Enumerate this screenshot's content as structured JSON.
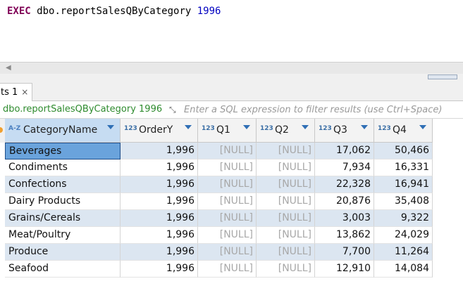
{
  "editor": {
    "keyword": "EXEC",
    "procedure": "dbo.reportSalesQByCategory",
    "argument": "1996"
  },
  "results_tab": {
    "label": "ts 1",
    "close_glyph": "×"
  },
  "filter": {
    "query_name": "dbo.reportSalesQByCategory 1996",
    "placeholder": "Enter a SQL expression to filter results (use Ctrl+Space)"
  },
  "columns": [
    {
      "type": "A-Z",
      "label": "CategoryName"
    },
    {
      "type": "123",
      "label": "OrderY"
    },
    {
      "type": "123",
      "label": "Q1"
    },
    {
      "type": "123",
      "label": "Q2"
    },
    {
      "type": "123",
      "label": "Q3"
    },
    {
      "type": "123",
      "label": "Q4"
    }
  ],
  "rows": [
    {
      "category": "Beverages",
      "ordery": "1,996",
      "q1": "[NULL]",
      "q2": "[NULL]",
      "q3": "17,062",
      "q4": "50,466"
    },
    {
      "category": "Condiments",
      "ordery": "1,996",
      "q1": "[NULL]",
      "q2": "[NULL]",
      "q3": "7,934",
      "q4": "16,331"
    },
    {
      "category": "Confections",
      "ordery": "1,996",
      "q1": "[NULL]",
      "q2": "[NULL]",
      "q3": "22,328",
      "q4": "16,941"
    },
    {
      "category": "Dairy Products",
      "ordery": "1,996",
      "q1": "[NULL]",
      "q2": "[NULL]",
      "q3": "20,876",
      "q4": "35,408"
    },
    {
      "category": "Grains/Cereals",
      "ordery": "1,996",
      "q1": "[NULL]",
      "q2": "[NULL]",
      "q3": "3,003",
      "q4": "9,322"
    },
    {
      "category": "Meat/Poultry",
      "ordery": "1,996",
      "q1": "[NULL]",
      "q2": "[NULL]",
      "q3": "13,862",
      "q4": "24,029"
    },
    {
      "category": "Produce",
      "ordery": "1,996",
      "q1": "[NULL]",
      "q2": "[NULL]",
      "q3": "7,700",
      "q4": "11,264"
    },
    {
      "category": "Seafood",
      "ordery": "1,996",
      "q1": "[NULL]",
      "q2": "[NULL]",
      "q3": "12,910",
      "q4": "14,084"
    }
  ]
}
